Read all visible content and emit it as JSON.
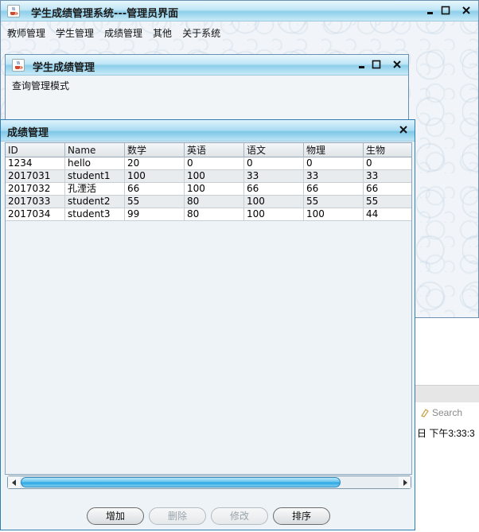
{
  "main_window": {
    "title": "学生成绩管理系统---管理员界面",
    "menu": [
      "教师管理",
      "学生管理",
      "成绩管理",
      "其他",
      "关于系统"
    ]
  },
  "inner_window": {
    "title": "学生成绩管理",
    "body_text": "查询管理模式"
  },
  "grades_window": {
    "title": "成绩管理",
    "columns": [
      "ID",
      "Name",
      "数学",
      "英语",
      "语文",
      "物理",
      "生物"
    ],
    "rows": [
      [
        "1234",
        "hello",
        "20",
        "0",
        "0",
        "0",
        "0"
      ],
      [
        "2017031",
        "student1",
        "100",
        "100",
        "33",
        "33",
        "33"
      ],
      [
        "2017032",
        "孔湮活",
        "66",
        "100",
        "66",
        "66",
        "66"
      ],
      [
        "2017033",
        "student2",
        "55",
        "80",
        "100",
        "55",
        "55"
      ],
      [
        "2017034",
        "student3",
        "99",
        "80",
        "100",
        "100",
        "44"
      ]
    ],
    "buttons": {
      "add": "增加",
      "delete": "删除",
      "modify": "修改",
      "sort": "排序"
    }
  },
  "background": {
    "search_label": "Search",
    "time_text": "日 下午3:33:3"
  },
  "colors": {
    "titlebar": "#8ecfea",
    "scroll_thumb": "#2aa6e2",
    "frame_border": "#2e7eb4"
  }
}
